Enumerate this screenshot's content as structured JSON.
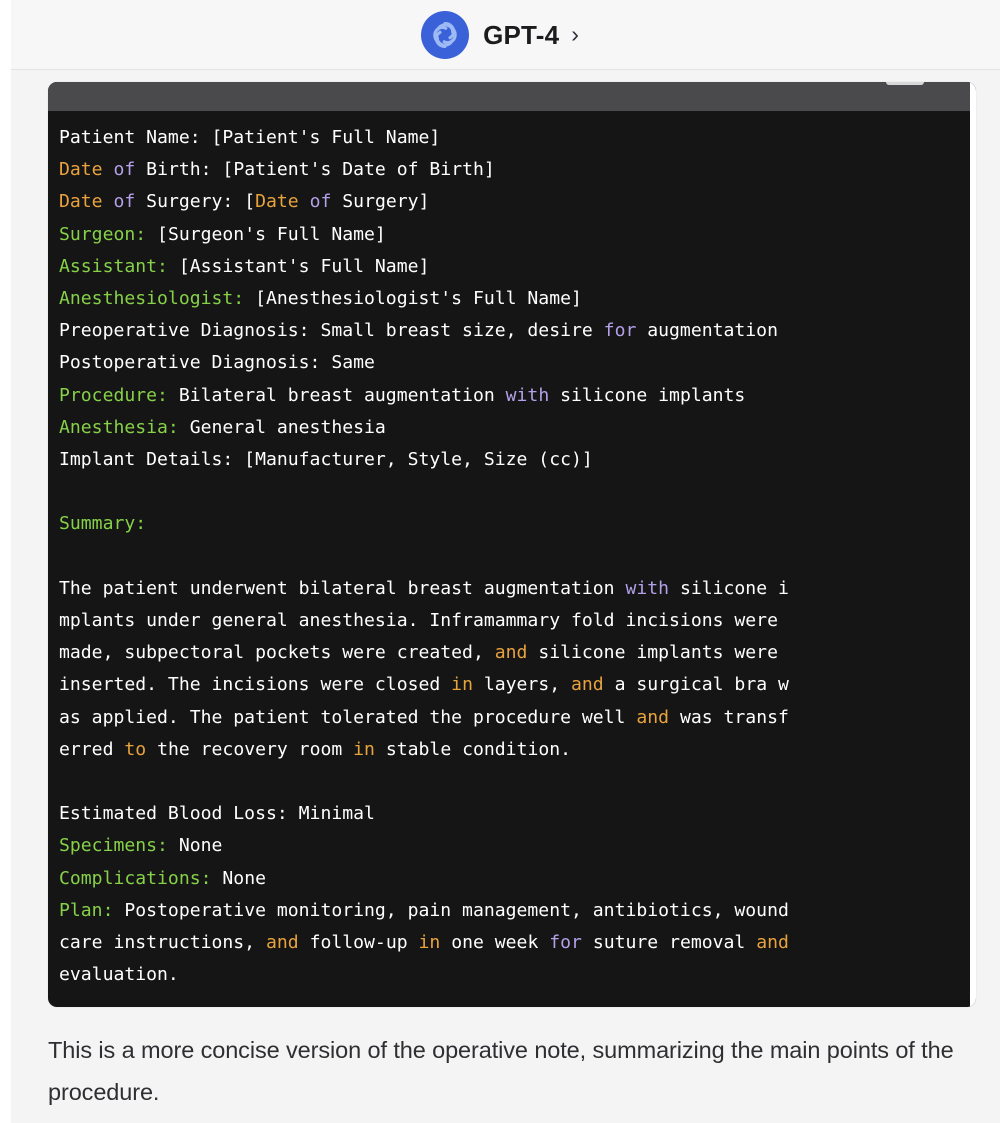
{
  "header": {
    "model_name": "GPT-4",
    "chevron": "›",
    "logo_icon": "openai-logo-icon",
    "logo_color": "#3b61d8",
    "background": "#f7f7f7"
  },
  "code_block": {
    "background": "#151515",
    "header_background": "#4a4a4d",
    "language": "",
    "colors": {
      "text": "#ffffff",
      "orange": "#e8a33d",
      "green": "#86d148",
      "purple": "#b3a0e8"
    },
    "lines": [
      [
        {
          "t": "Patient Name: [Patient's Full Name]",
          "c": "white"
        }
      ],
      [
        {
          "t": "Date",
          "c": "orange"
        },
        {
          "t": " ",
          "c": "white"
        },
        {
          "t": "of",
          "c": "purple"
        },
        {
          "t": " Birth: [Patient's Date of Birth]",
          "c": "white"
        }
      ],
      [
        {
          "t": "Date",
          "c": "orange"
        },
        {
          "t": " ",
          "c": "white"
        },
        {
          "t": "of",
          "c": "purple"
        },
        {
          "t": " Surgery: [",
          "c": "white"
        },
        {
          "t": "Date",
          "c": "orange"
        },
        {
          "t": " ",
          "c": "white"
        },
        {
          "t": "of",
          "c": "purple"
        },
        {
          "t": " Surgery]",
          "c": "white"
        }
      ],
      [
        {
          "t": "Surgeon:",
          "c": "green"
        },
        {
          "t": " [Surgeon's Full Name]",
          "c": "white"
        }
      ],
      [
        {
          "t": "Assistant:",
          "c": "green"
        },
        {
          "t": " [Assistant's Full Name]",
          "c": "white"
        }
      ],
      [
        {
          "t": "Anesthesiologist:",
          "c": "green"
        },
        {
          "t": " [Anesthesiologist's Full Name]",
          "c": "white"
        }
      ],
      [
        {
          "t": "Preoperative Diagnosis: Small breast size, desire ",
          "c": "white"
        },
        {
          "t": "for",
          "c": "purple"
        },
        {
          "t": " augmentation",
          "c": "white"
        }
      ],
      [
        {
          "t": "Postoperative Diagnosis: Same",
          "c": "white"
        }
      ],
      [
        {
          "t": "Procedure:",
          "c": "green"
        },
        {
          "t": " Bilateral breast augmentation ",
          "c": "white"
        },
        {
          "t": "with",
          "c": "purple"
        },
        {
          "t": " silicone implants",
          "c": "white"
        }
      ],
      [
        {
          "t": "Anesthesia:",
          "c": "green"
        },
        {
          "t": " General anesthesia",
          "c": "white"
        }
      ],
      [
        {
          "t": "Implant Details: [Manufacturer, Style, Size (cc)]",
          "c": "white"
        }
      ],
      [],
      [
        {
          "t": "Summary:",
          "c": "green"
        }
      ],
      [],
      [
        {
          "t": "The patient underwent bilateral breast augmentation ",
          "c": "white"
        },
        {
          "t": "with",
          "c": "purple"
        },
        {
          "t": " silicone i",
          "c": "white"
        }
      ],
      [
        {
          "t": "mplants under general anesthesia. Inframammary fold incisions were",
          "c": "white"
        }
      ],
      [
        {
          "t": "made, subpectoral pockets were created, ",
          "c": "white"
        },
        {
          "t": "and",
          "c": "orange"
        },
        {
          "t": " silicone implants were",
          "c": "white"
        }
      ],
      [
        {
          "t": "inserted. The incisions were closed ",
          "c": "white"
        },
        {
          "t": "in",
          "c": "orange"
        },
        {
          "t": " layers, ",
          "c": "white"
        },
        {
          "t": "and",
          "c": "orange"
        },
        {
          "t": " a surgical bra w",
          "c": "white"
        }
      ],
      [
        {
          "t": "as applied. The patient tolerated the procedure well ",
          "c": "white"
        },
        {
          "t": "and",
          "c": "orange"
        },
        {
          "t": " was transf",
          "c": "white"
        }
      ],
      [
        {
          "t": "erred ",
          "c": "white"
        },
        {
          "t": "to",
          "c": "orange"
        },
        {
          "t": " the recovery room ",
          "c": "white"
        },
        {
          "t": "in",
          "c": "orange"
        },
        {
          "t": " stable condition.",
          "c": "white"
        }
      ],
      [],
      [
        {
          "t": "Estimated Blood Loss: Minimal",
          "c": "white"
        }
      ],
      [
        {
          "t": "Specimens:",
          "c": "green"
        },
        {
          "t": " None",
          "c": "white"
        }
      ],
      [
        {
          "t": "Complications:",
          "c": "green"
        },
        {
          "t": " None",
          "c": "white"
        }
      ],
      [
        {
          "t": "Plan:",
          "c": "green"
        },
        {
          "t": " Postoperative monitoring, pain management, antibiotics, wound",
          "c": "white"
        }
      ],
      [
        {
          "t": "care instructions, ",
          "c": "white"
        },
        {
          "t": "and",
          "c": "orange"
        },
        {
          "t": " follow-up ",
          "c": "white"
        },
        {
          "t": "in",
          "c": "orange"
        },
        {
          "t": " one week ",
          "c": "white"
        },
        {
          "t": "for",
          "c": "purple"
        },
        {
          "t": " suture removal ",
          "c": "white"
        },
        {
          "t": "and",
          "c": "orange"
        }
      ],
      [
        {
          "t": "evaluation.",
          "c": "white"
        }
      ]
    ]
  },
  "trailing_paragraph": "This is a more concise version of the operative note, summarizing the main points of the procedure."
}
